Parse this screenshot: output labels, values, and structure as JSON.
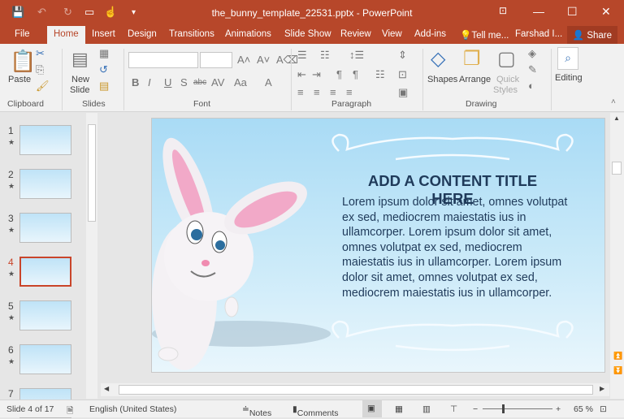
{
  "window": {
    "title": "the_bunny_template_22531.pptx - PowerPoint"
  },
  "tabs": [
    "File",
    "Home",
    "Insert",
    "Design",
    "Transitions",
    "Animations",
    "Slide Show",
    "Review",
    "View",
    "Add-ins",
    "Tell me...",
    "Farshad I...",
    "Share"
  ],
  "ribbon": {
    "paste": "Paste",
    "new_slide": "New",
    "new_slide2": "Slide",
    "shapes": "Shapes",
    "arrange": "Arrange",
    "quick": "Quick",
    "quick2": "Styles",
    "editing": "Editing",
    "groups": [
      "Clipboard",
      "Slides",
      "Font",
      "Paragraph",
      "Drawing"
    ]
  },
  "thumbnails": [
    {
      "n": "1"
    },
    {
      "n": "2"
    },
    {
      "n": "3"
    },
    {
      "n": "4",
      "selected": true
    },
    {
      "n": "5"
    },
    {
      "n": "6"
    },
    {
      "n": "7"
    }
  ],
  "slide": {
    "title": "ADD A CONTENT TITLE HERE",
    "body": "Lorem ipsum dolor sit amet, omnes volutpat ex sed, mediocrem maiestatis ius in ullamcorper. Lorem ipsum dolor sit amet, omnes volutpat ex sed, mediocrem maiestatis ius in ullamcorper. Lorem ipsum dolor sit amet, omnes volutpat ex sed, mediocrem maiestatis ius in ullamcorper."
  },
  "status": {
    "slide": "Slide 4 of 17",
    "language": "English (United States)",
    "notes": "Notes",
    "comments": "Comments",
    "zoom": "65 %",
    "zoom_value": 65
  },
  "colors": {
    "accent": "#b7472a",
    "title_text": "#1f3a5a"
  }
}
